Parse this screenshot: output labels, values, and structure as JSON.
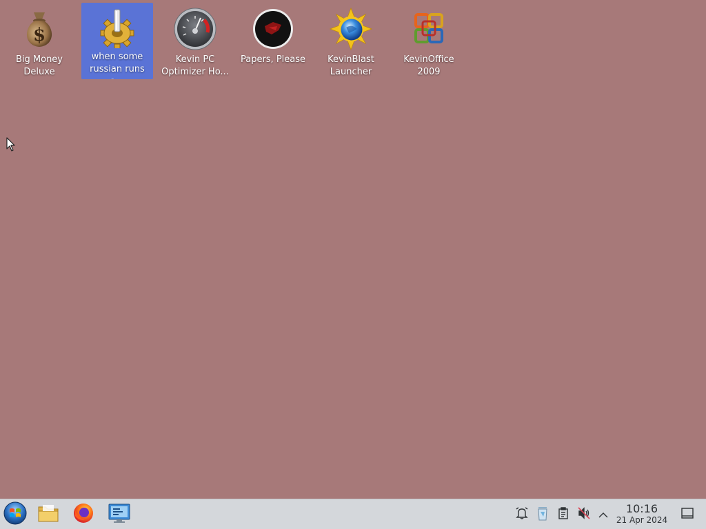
{
  "desktop": {
    "background_color": "#a77979",
    "selection_color": "#5a73d6",
    "icons": [
      {
        "label": "Big Money\nDeluxe",
        "icon": "money-bag-icon"
      },
      {
        "label": "when some\nrussian runs a...",
        "icon": "gear-icon"
      },
      {
        "label": "Kevin PC\nOptimizer Ho...",
        "icon": "speedometer-icon"
      },
      {
        "label": "Papers, Please",
        "icon": "papers-please-icon"
      },
      {
        "label": "KevinBlast\nLauncher",
        "icon": "sun-globe-icon"
      },
      {
        "label": "KevinOffice\n2009",
        "icon": "office-logo-icon"
      }
    ]
  },
  "taskbar": {
    "background_color": "#d4d7db",
    "pinned": [
      {
        "name": "start-menu",
        "icon": "windows-orb-icon"
      },
      {
        "name": "file-manager",
        "icon": "folder-icon"
      },
      {
        "name": "firefox",
        "icon": "firefox-icon"
      },
      {
        "name": "system-settings",
        "icon": "monitor-icon"
      }
    ],
    "tray": [
      {
        "name": "notifications",
        "icon": "bell-icon"
      },
      {
        "name": "clipboard-bin",
        "icon": "recycle-bin-icon"
      },
      {
        "name": "clipboard",
        "icon": "clipboard-icon"
      },
      {
        "name": "volume-muted",
        "icon": "speaker-muted-icon"
      },
      {
        "name": "show-hidden",
        "icon": "chevron-up-icon"
      }
    ],
    "clock": {
      "time": "10:16",
      "date": "21 Apr 2024"
    },
    "show_desktop_icon": "show-desktop-icon"
  }
}
